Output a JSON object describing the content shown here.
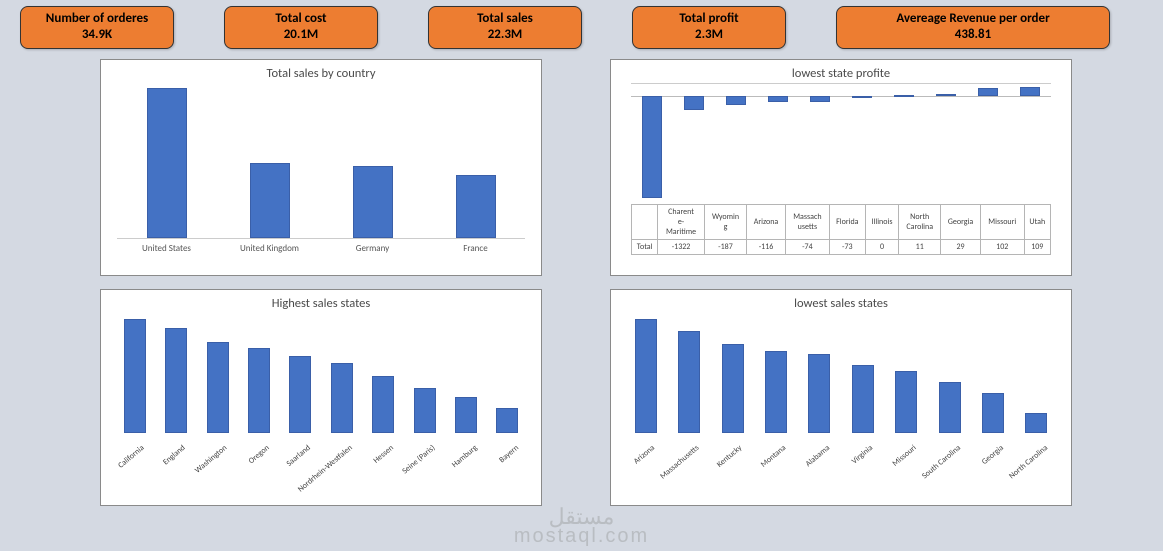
{
  "kpi": [
    {
      "label": "Number of orderes",
      "value": "34.9K"
    },
    {
      "label": "Total cost",
      "value": "20.1M"
    },
    {
      "label": "Total sales",
      "value": "22.3M"
    },
    {
      "label": "Total profit",
      "value": "2.3M"
    },
    {
      "label": "Avereage Revenue per order",
      "value": "438.81"
    }
  ],
  "chart_data": [
    {
      "id": "sales_by_country",
      "type": "bar",
      "title": "Total sales by country",
      "categories": [
        "United States",
        "United Kingdom",
        "Germany",
        "France"
      ],
      "values": [
        100,
        50,
        48,
        42
      ],
      "ylim": [
        0,
        100
      ],
      "note": "relative heights; no y-axis labels shown in image"
    },
    {
      "id": "lowest_state_profit",
      "type": "bar",
      "title": "lowest state profite",
      "categories": [
        "Charente-Maritime",
        "Wyoming",
        "Arizona",
        "Massachusetts",
        "Florida",
        "Illinois",
        "North Carolina",
        "Georgia",
        "Missouri",
        "Utah"
      ],
      "series": [
        {
          "name": "Total",
          "values": [
            -1322,
            -187,
            -116,
            -74,
            -73,
            0,
            11,
            29,
            102,
            109
          ]
        }
      ],
      "ylim": [
        -1400,
        150
      ],
      "table_label": "Total"
    },
    {
      "id": "highest_sales_states",
      "type": "bar",
      "title": "Highest sales states",
      "categories": [
        "California",
        "England",
        "Washington",
        "Oregon",
        "Saarland",
        "Nordrhein-Westfalen",
        "Hessen",
        "Seine (Paris)",
        "Hamburg",
        "Bayern"
      ],
      "values": [
        100,
        92,
        80,
        75,
        68,
        62,
        50,
        40,
        32,
        22
      ],
      "ylim": [
        0,
        100
      ],
      "note": "relative heights; no y-axis labels shown in image"
    },
    {
      "id": "lowest_sales_states",
      "type": "bar",
      "title": "lowest sales states",
      "categories": [
        "Arizona",
        "Massachusetts",
        "Kentucky",
        "Montana",
        "Alabama",
        "Virginia",
        "Missouri",
        "South Carolina",
        "Georgia",
        "North Carolina"
      ],
      "values": [
        100,
        90,
        78,
        72,
        70,
        60,
        55,
        45,
        35,
        18
      ],
      "ylim": [
        0,
        100
      ],
      "note": "relative heights; no y-axis labels shown in image"
    }
  ],
  "watermark": {
    "ar": "مستقل",
    "lat": "mostaql.com"
  }
}
